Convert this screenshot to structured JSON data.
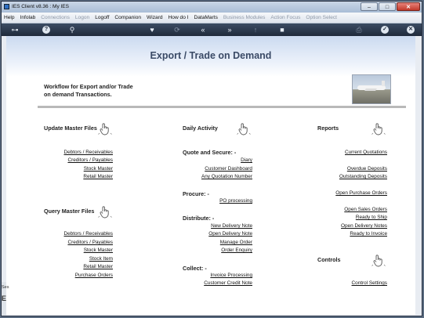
{
  "window": {
    "title": "IES Client v8.36 : My IES",
    "min_glyph": "–",
    "max_glyph": "□",
    "close_glyph": "✕"
  },
  "menu": [
    {
      "label": "Help",
      "enabled": true
    },
    {
      "label": "Infolab",
      "enabled": true
    },
    {
      "label": "Connections",
      "enabled": false
    },
    {
      "label": "Logon",
      "enabled": false
    },
    {
      "label": "Logoff",
      "enabled": true
    },
    {
      "label": "Companion",
      "enabled": true
    },
    {
      "label": "Wizard",
      "enabled": true
    },
    {
      "label": "How do I",
      "enabled": true
    },
    {
      "label": "DataMarts",
      "enabled": true
    },
    {
      "label": "Business Modules",
      "enabled": false
    },
    {
      "label": "Action Focus",
      "enabled": false
    },
    {
      "label": "Option Select",
      "enabled": false
    }
  ],
  "toolbar": {
    "key_icon": "⊶",
    "help_icon": "?",
    "search_icon": "⚲",
    "favorite_icon": "♥",
    "refresh_icon": "⟳",
    "back_icon": "«",
    "forward_icon": "»",
    "up_icon": "↑",
    "stop_icon": "■",
    "print_icon": "⎙",
    "ok_icon": "✓",
    "close_icon": "✕"
  },
  "page": {
    "title": "Export / Trade on Demand",
    "intro_line1": "Workflow for Export and/or Trade",
    "intro_line2": "on demand Transactions."
  },
  "sections": {
    "update_master": "Update Master Files",
    "query_master": "Query Master Files",
    "daily_activity": "Daily Activity",
    "quote_secure": "Quote and Secure: -",
    "procure": "Procure: -",
    "distribute": "Distribute: -",
    "collect": "Collect: -",
    "reports": "Reports",
    "controls": "Controls"
  },
  "links": {
    "update_master": [
      "Debtors / Receivables",
      "Creditors / Payables",
      "Stock Master",
      "Retail Master"
    ],
    "query_master": [
      "Debtors / Receivables",
      "Creditors / Payables",
      "Stock Master",
      "Stock Item",
      "Retail Master",
      "Purchase Orders"
    ],
    "quote_secure": [
      "Diary",
      "Customer Dashboard",
      "Any Quotation Number"
    ],
    "procure": [
      "PO processing"
    ],
    "distribute": [
      "New Delivery Note",
      "Open Delivery Note",
      "Manage Order",
      "Order Enquiry"
    ],
    "collect": [
      "Invoice Processing",
      "Customer Credit Note"
    ],
    "reports_a": [
      "Current Quotations"
    ],
    "reports_b": [
      "Overdue Deposits",
      "Outstanding Deposits"
    ],
    "reports_c": [
      "Open Purchase Orders"
    ],
    "reports_d": [
      "Open Sales Orders",
      "Ready to Ship",
      "Open Delivery Notes",
      "Ready to Invoice"
    ],
    "controls": [
      "Control Settings"
    ]
  },
  "side_strip": [
    "Ses",
    "E"
  ],
  "icons": {
    "section": "hand-pointer-icon",
    "hero": "airplane-photo"
  }
}
